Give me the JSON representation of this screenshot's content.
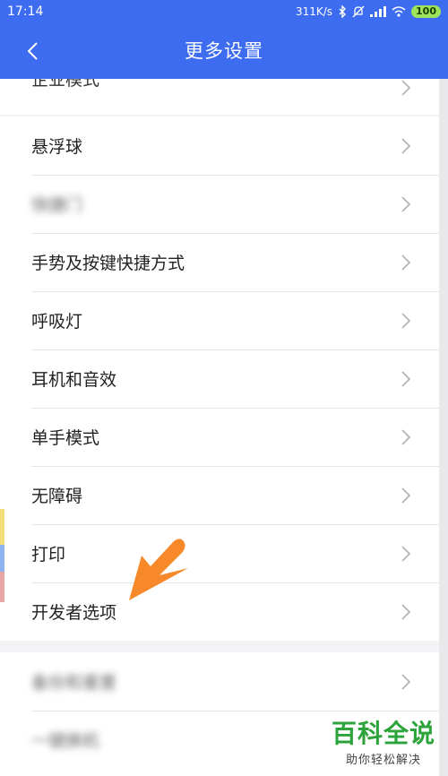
{
  "status": {
    "time": "17:14",
    "network_speed": "311K/s",
    "battery": "100"
  },
  "header": {
    "title": "更多设置"
  },
  "sections": [
    {
      "items": [
        {
          "label": "企业模式"
        }
      ]
    },
    {
      "items": [
        {
          "label": "悬浮球"
        },
        {
          "label": "快捷门",
          "blurred": true
        },
        {
          "label": "手势及按键快捷方式"
        },
        {
          "label": "呼吸灯"
        },
        {
          "label": "耳机和音效"
        },
        {
          "label": "单手模式"
        },
        {
          "label": "无障碍"
        },
        {
          "label": "打印"
        },
        {
          "label": "开发者选项"
        }
      ]
    },
    {
      "items": [
        {
          "label": "备份和重置",
          "blurred": true
        },
        {
          "label": "一键换机",
          "blurred": true
        }
      ]
    }
  ],
  "watermark": {
    "main": "百科全说",
    "sub": "助你轻松解决"
  },
  "colors": {
    "header": "#3d6cf0",
    "arrow": "#f7892a",
    "watermark": "#2da33b"
  }
}
